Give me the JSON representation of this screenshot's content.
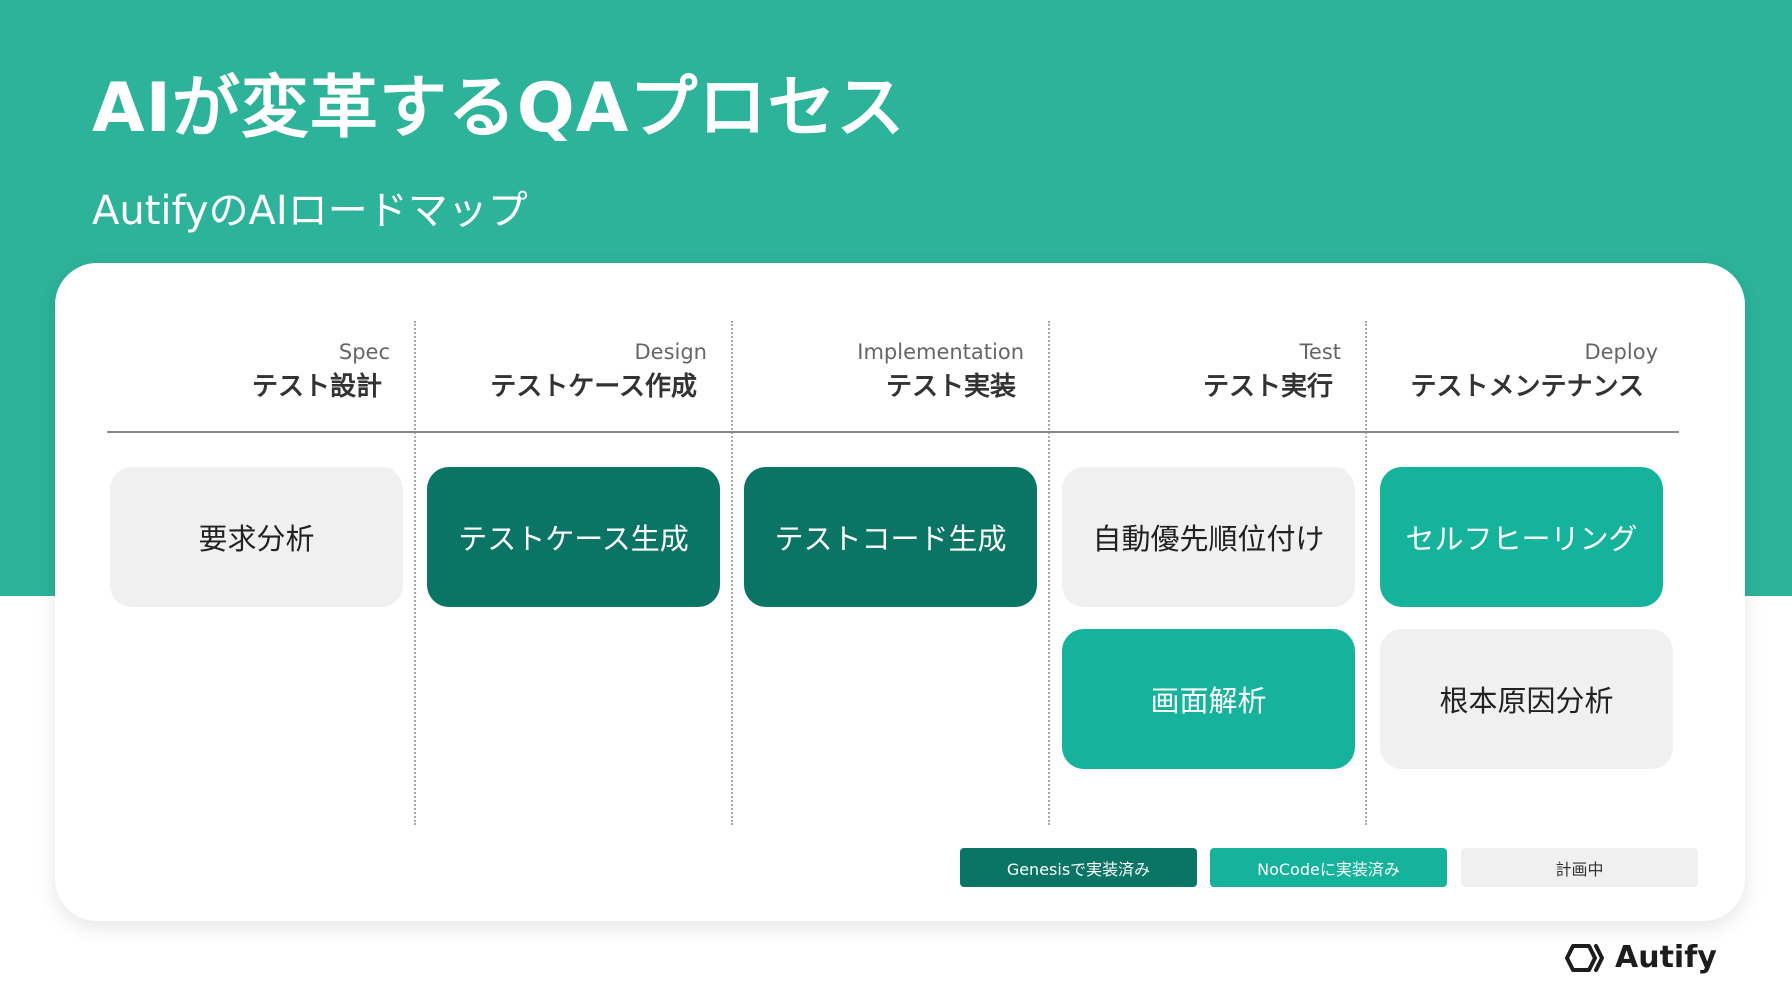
{
  "slide": {
    "title": "AIが変革するQAプロセス",
    "subtitle": "AutifyのAIロードマップ"
  },
  "columns": [
    {
      "en": "Spec",
      "jp": "テスト設計"
    },
    {
      "en": "Design",
      "jp": "テストケース作成"
    },
    {
      "en": "Implementation",
      "jp": "テスト実装"
    },
    {
      "en": "Test",
      "jp": "テスト実行"
    },
    {
      "en": "Deploy",
      "jp": "テストメンテナンス"
    }
  ],
  "items": {
    "requirements_analysis": {
      "label": "要求分析",
      "status": "planned"
    },
    "test_case_generation": {
      "label": "テストケース生成",
      "status": "genesis"
    },
    "test_code_generation": {
      "label": "テストコード生成",
      "status": "genesis"
    },
    "auto_prioritization": {
      "label": "自動優先順位付け",
      "status": "planned"
    },
    "self_healing": {
      "label": "セルフヒーリング",
      "status": "nocode"
    },
    "screen_analysis": {
      "label": "画面解析",
      "status": "nocode"
    },
    "root_cause_analysis": {
      "label": "根本原因分析",
      "status": "planned"
    }
  },
  "legend": {
    "genesis": "Genesisで実装済み",
    "nocode": "NoCodeに実装済み",
    "planned": "計画中"
  },
  "logo": {
    "text": "Autify"
  },
  "colors": {
    "background_band": "#2db39a",
    "genesis": "#0a7565",
    "nocode": "#15b39b",
    "planned": "#f0f0f0"
  }
}
